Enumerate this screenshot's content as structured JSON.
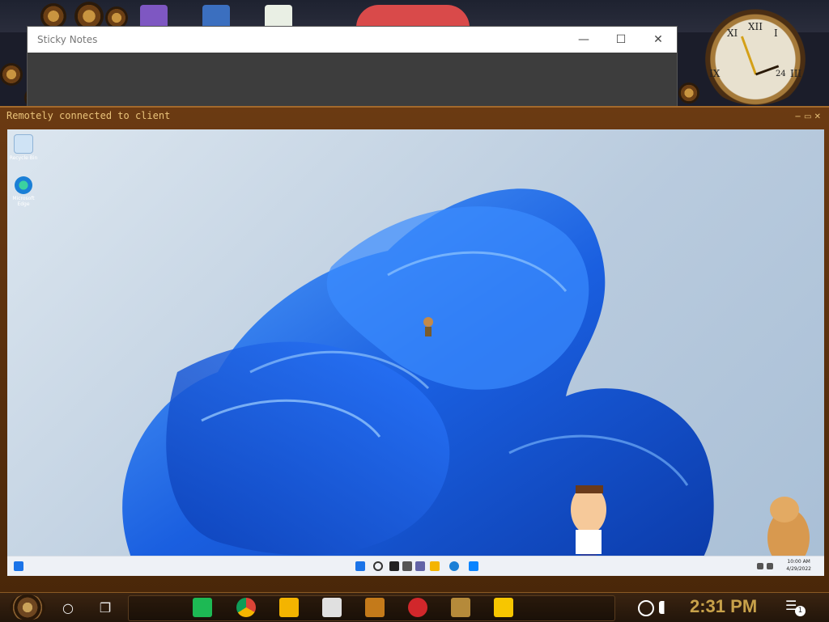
{
  "sticky_notes": {
    "title": "Sticky Notes",
    "minimize": "—",
    "maximize": "☐",
    "close": "✕"
  },
  "remote_window": {
    "title": "Remotely connected to client",
    "controls": "− ▭ ✕"
  },
  "guest_desktop": {
    "icons": [
      {
        "label": "Recycle Bin",
        "icon": "recycle-bin-icon"
      },
      {
        "label": "Microsoft Edge",
        "icon": "edge-icon"
      }
    ],
    "taskbar": {
      "time": "10:00 AM",
      "date": "4/29/2022"
    }
  },
  "host_taskbar": {
    "search_glyph": "○",
    "taskview_glyph": "❐",
    "apps": [
      {
        "name": "sticky-notes-green",
        "color": "#1db954"
      },
      {
        "name": "chrome",
        "color": "#db4437"
      },
      {
        "name": "file-explorer",
        "color": "#f4b400"
      },
      {
        "name": "skull-app",
        "color": "#e0e0e0"
      },
      {
        "name": "dreamweaver-de",
        "color": "#c47a1a"
      },
      {
        "name": "red-app",
        "color": "#d1272b"
      },
      {
        "name": "image-app",
        "color": "#b58a3a"
      },
      {
        "name": "sticky-notes-yellow",
        "color": "#f7c600"
      }
    ],
    "clock": "2:31 PM",
    "notification_count": "1"
  },
  "clock_gadget": {
    "numerals": [
      "XII",
      "XI",
      "I",
      "IX",
      "III",
      "24"
    ]
  }
}
